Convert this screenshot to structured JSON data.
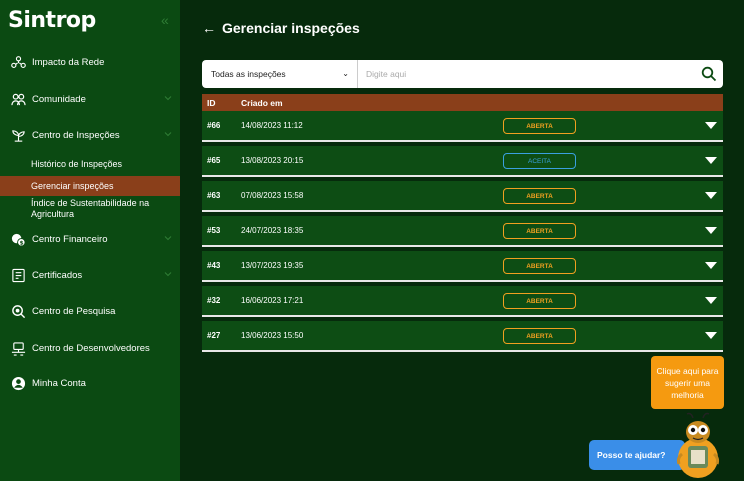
{
  "app": {
    "logo": "Sintrop"
  },
  "sidebar": {
    "items": [
      {
        "label": "Impacto da Rede",
        "icon": "network-icon"
      },
      {
        "label": "Comunidade",
        "icon": "community-icon"
      },
      {
        "label": "Centro de Inspeções",
        "icon": "inspection-icon"
      },
      {
        "label": "Centro Financeiro",
        "icon": "finance-icon"
      },
      {
        "label": "Certificados",
        "icon": "certificate-icon"
      },
      {
        "label": "Centro de Pesquisa",
        "icon": "research-icon"
      },
      {
        "label": "Centro de Desenvolvedores",
        "icon": "developers-icon"
      },
      {
        "label": "Minha Conta",
        "icon": "account-icon"
      }
    ],
    "subitems": [
      {
        "label": "Histórico de Inspeções"
      },
      {
        "label": "Gerenciar inspeções"
      },
      {
        "label": "Índice de Sustentabilidade na Agricultura"
      }
    ]
  },
  "main": {
    "title": "Gerenciar inspeções",
    "filter": {
      "selected": "Todas as inspeções"
    },
    "search": {
      "placeholder": "Digite aqui"
    },
    "table": {
      "headers": [
        "ID",
        "Criado em"
      ],
      "rows": [
        {
          "id": "#66",
          "created": "14/08/2023 11:12",
          "status": "ABERTA"
        },
        {
          "id": "#65",
          "created": "13/08/2023 20:15",
          "status": "ACEITA"
        },
        {
          "id": "#63",
          "created": "07/08/2023 15:58",
          "status": "ABERTA"
        },
        {
          "id": "#53",
          "created": "24/07/2023 18:35",
          "status": "ABERTA"
        },
        {
          "id": "#43",
          "created": "13/07/2023 19:35",
          "status": "ABERTA"
        },
        {
          "id": "#32",
          "created": "16/06/2023 17:21",
          "status": "ABERTA"
        },
        {
          "id": "#27",
          "created": "13/06/2023 15:50",
          "status": "ABERTA"
        }
      ]
    }
  },
  "suggest": {
    "label": "Clique aqui para sugerir uma melhoria"
  },
  "help": {
    "label": "Posso te ajudar?"
  },
  "colors": {
    "sidebar": "#0b4a12",
    "background": "#062a0c",
    "accent": "#8a3f1a",
    "open": "#f0a020",
    "accepted": "#3aa0e0"
  }
}
